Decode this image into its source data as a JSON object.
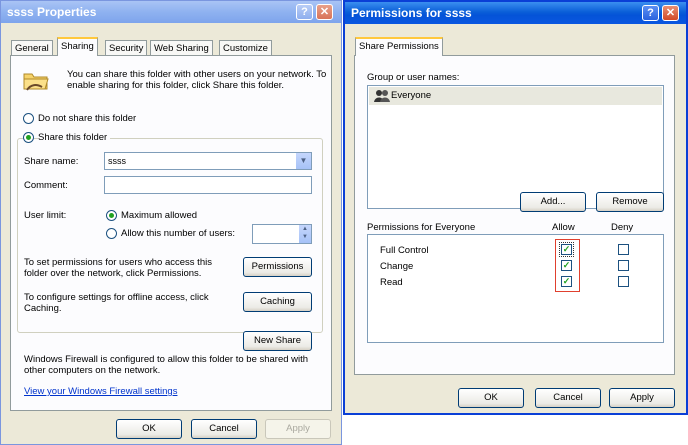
{
  "left_window": {
    "title": "ssss Properties",
    "tabs": [
      "General",
      "Sharing",
      "Security",
      "Web Sharing",
      "Customize"
    ],
    "intro_text": "You can share this folder with other users on your network.  To enable sharing for this folder, click Share this folder.",
    "radio_do_not_share": "Do not share this folder",
    "radio_share": "Share this folder",
    "share_name_label": "Share name:",
    "share_name_value": "ssss",
    "comment_label": "Comment:",
    "comment_value": "",
    "user_limit_label": "User limit:",
    "max_allowed": "Maximum allowed",
    "allow_number": "Allow this number of users:",
    "permissions_text": "To set permissions for users who access this folder over the network, click Permissions.",
    "permissions_button": "Permissions",
    "caching_text": "To configure settings for offline access, click Caching.",
    "caching_button": "Caching",
    "new_share_button": "New Share",
    "firewall_text": "Windows Firewall is configured to allow this folder to be shared with other computers on the network.",
    "firewall_link": "View your Windows Firewall settings",
    "ok": "OK",
    "cancel": "Cancel",
    "apply": "Apply"
  },
  "right_window": {
    "title": "Permissions for ssss",
    "tab": "Share Permissions",
    "group_label": "Group or user names:",
    "users": [
      "Everyone"
    ],
    "add_button": "Add...",
    "remove_button": "Remove",
    "perm_header": "Permissions for Everyone",
    "allow_header": "Allow",
    "deny_header": "Deny",
    "permissions": [
      {
        "name": "Full Control",
        "allow": true,
        "deny": false
      },
      {
        "name": "Change",
        "allow": true,
        "deny": false
      },
      {
        "name": "Read",
        "allow": true,
        "deny": false
      }
    ],
    "ok": "OK",
    "cancel": "Cancel",
    "apply": "Apply"
  },
  "colors": {
    "highlight": "#e0402e",
    "check": "#21a121"
  }
}
